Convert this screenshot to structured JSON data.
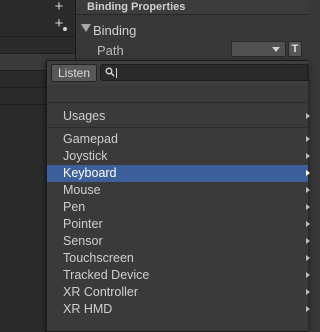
{
  "left_panel": {
    "add_icon": "plus-icon",
    "add_with_options_icon": "plus-dot-icon"
  },
  "binding_properties": {
    "title": "Binding Properties",
    "section_label": "Binding",
    "path_label": "Path",
    "path_value": "",
    "text_mode_label": "T"
  },
  "popup": {
    "listen_label": "Listen",
    "search": {
      "value": "",
      "placeholder": ""
    },
    "header_item": "Usages",
    "items": [
      "Gamepad",
      "Joystick",
      "Keyboard",
      "Mouse",
      "Pen",
      "Pointer",
      "Sensor",
      "Touchscreen",
      "Tracked Device",
      "XR Controller",
      "XR HMD"
    ],
    "selected_item": "Keyboard"
  },
  "colors": {
    "selection": "#3d5f9b",
    "background": "#383838",
    "panel": "#2b2b2b"
  }
}
